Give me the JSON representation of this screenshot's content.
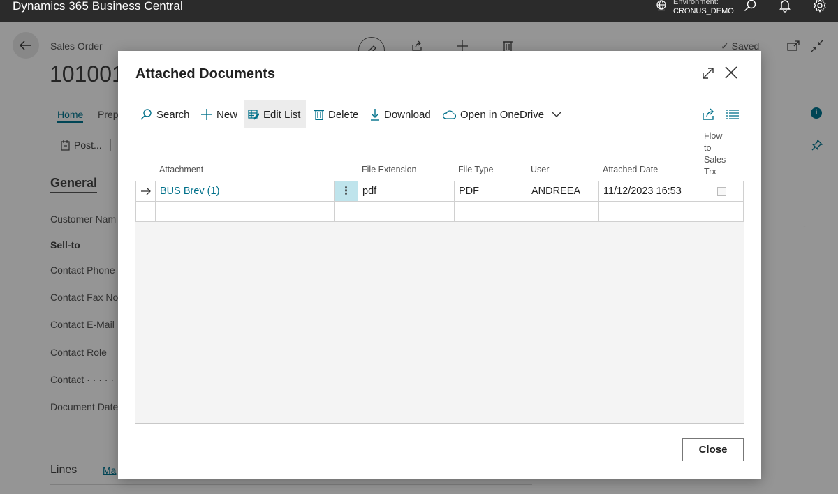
{
  "topbar": {
    "app_title": "Dynamics 365 Business Central",
    "env_label": "Environment:",
    "env_name": "CRONUS_DEMO"
  },
  "background": {
    "caption": "Sales Order",
    "number": "101001 ·",
    "tab_home": "Home",
    "tab_prep": "Prep",
    "post": "Post...",
    "general": "General",
    "sell_to": "Sell-to",
    "fields": [
      "Customer Nam",
      "Contact Phone",
      "Contact Fax No",
      "Contact E-Mail",
      "Contact Role",
      "Contact · · · · ·",
      "Document Date"
    ],
    "lines": "Lines",
    "ma": "Ma",
    "saved": "Saved",
    "dash": "-"
  },
  "dialog": {
    "title": "Attached Documents",
    "toolbar": {
      "search": "Search",
      "new": "New",
      "edit_list": "Edit List",
      "delete": "Delete",
      "download": "Download",
      "open_onedrive": "Open in OneDrive"
    },
    "columns": {
      "attachment": "Attachment",
      "file_extension": "File Extension",
      "file_type": "File Type",
      "user": "User",
      "attached_date": "Attached Date",
      "flow_line1": "Flow",
      "flow_line2": "to",
      "flow_line3": "Sales",
      "flow_line4": "Trx"
    },
    "rows": [
      {
        "attachment": "BUS Brev (1)",
        "file_extension": "pdf",
        "file_type": "PDF",
        "user": "ANDREEA",
        "attached_date": "11/12/2023 16:53",
        "flow_to_sales": false
      }
    ],
    "close_label": "Close"
  },
  "colors": {
    "accent": "#00708a",
    "topbar": "#2b2b2b",
    "selected_cell": "#bfe4ec"
  }
}
